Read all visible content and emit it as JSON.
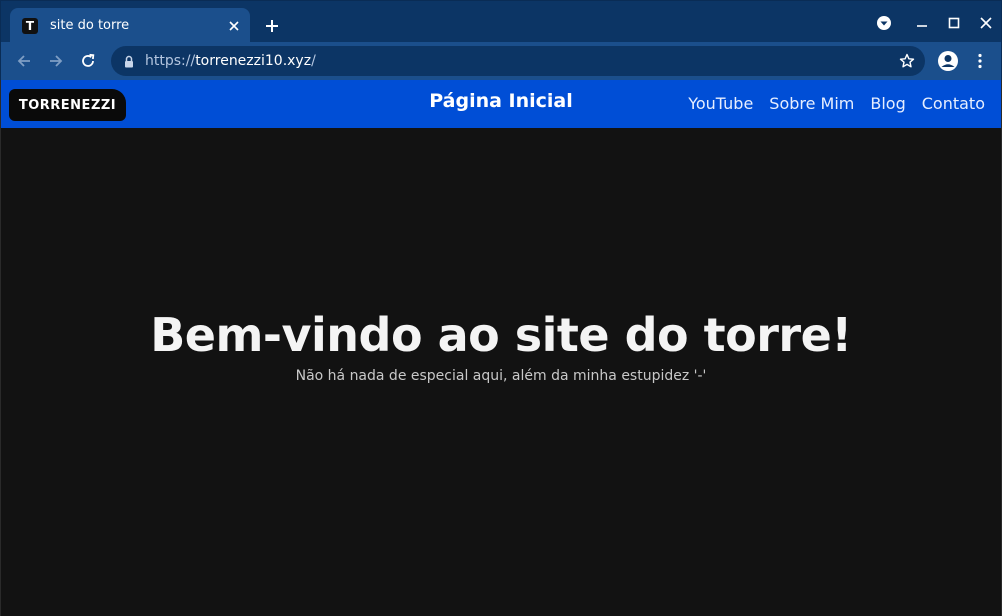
{
  "browser": {
    "tab": {
      "title": "site do torre",
      "favicon_letter": "T",
      "favicon_icon": "torrenezzi-favicon-icon"
    },
    "url": {
      "scheme": "https://",
      "host": "torrenezzi10.xyz",
      "path": "/"
    },
    "icons": {
      "tab_close": "close-icon",
      "new_tab": "plus-icon",
      "tab_search": "dropdown-circle-icon",
      "minimize": "minimize-icon",
      "maximize": "maximize-icon",
      "close_window": "close-icon",
      "back": "arrow-left-icon",
      "forward": "arrow-right-icon",
      "reload": "reload-icon",
      "lock": "lock-icon",
      "bookmark": "star-icon",
      "profile": "avatar-icon",
      "menu": "kebab-menu-icon"
    }
  },
  "site": {
    "logo_text": "TORRENEZZI",
    "page_title": "Página Inicial",
    "nav": [
      {
        "label": "YouTube"
      },
      {
        "label": "Sobre Mim"
      },
      {
        "label": "Blog"
      },
      {
        "label": "Contato"
      }
    ],
    "hero": {
      "heading": "Bem-vindo ao site do torre!",
      "subheading": "Não há nada de especial aqui, além da minha estupidez '-'"
    }
  },
  "colors": {
    "chrome_dark": "#0c3565",
    "chrome_light": "#1b4f8c",
    "navbar": "#004ed6",
    "page_bg": "#121212",
    "text_light": "#f4f4f4"
  }
}
